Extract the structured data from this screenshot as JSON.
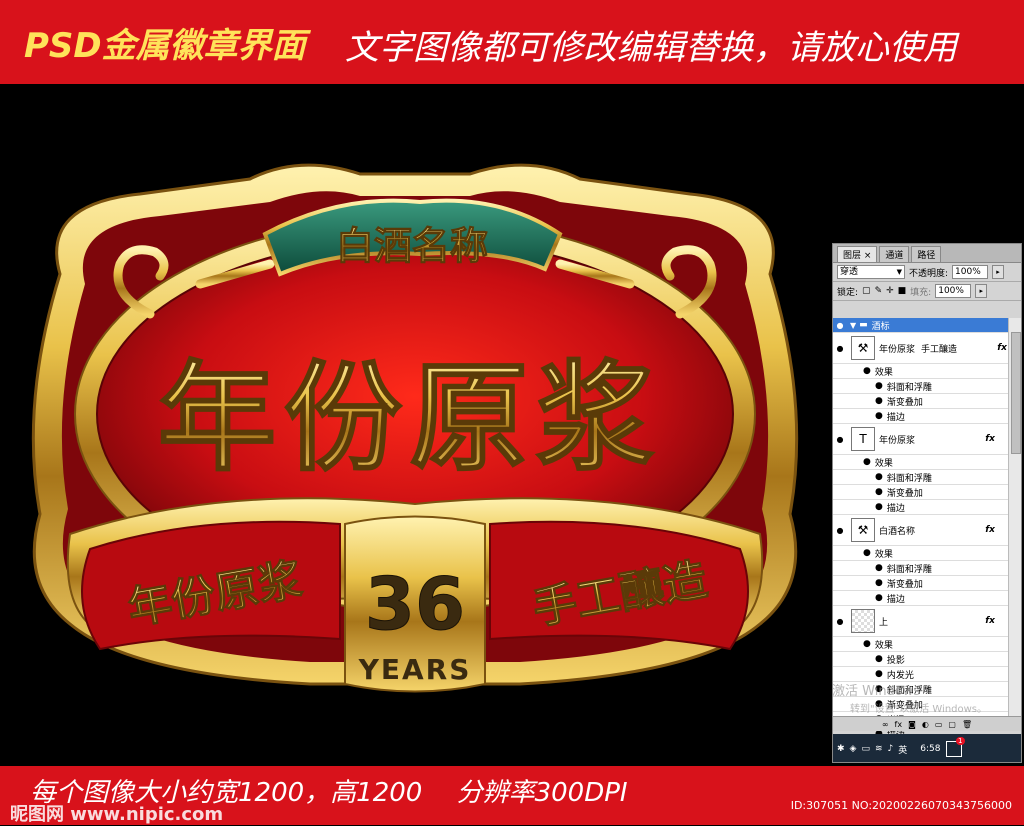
{
  "header": {
    "title": "PSD金属徽章界面",
    "subtitle": "文字图像都可修改编辑替换，请放心使用"
  },
  "footer": {
    "info": "每个图像大小约宽1200，高1200　 分辨率300DPI",
    "watermark": "昵图网 www.nipic.com",
    "id": "ID:307051 NO:20200226070343756000"
  },
  "badge": {
    "ribbon_text": "白酒名称",
    "main_text": "年份原浆",
    "left_label": "年份原浆",
    "right_label": "手工釀造",
    "number": "36",
    "years": "YEARS"
  },
  "colors": {
    "red": "#d8121b",
    "gold": "#e9c24a",
    "green": "#1e6b56",
    "yellow": "#ffe35a"
  },
  "ps_panel": {
    "tabs": [
      "图层 ×",
      "通道",
      "路径"
    ],
    "blend_mode": "穿透",
    "opacity_label": "不透明度:",
    "opacity_value": "100%",
    "lock_label": "锁定:",
    "fill_label": "填充:",
    "fill_value": "100%",
    "group_name": "酒标",
    "layer1_name": "年份原浆",
    "layer1_extra": "手工釀造",
    "layer2_name": "年份原浆",
    "layer3_name": "白酒名称",
    "layer4_name": "上",
    "fx": "fx",
    "effects_label": "效果",
    "effects_a": [
      "斜面和浮雕",
      "渐变叠加",
      "描边"
    ],
    "effects_b": [
      "斜面和浮雕",
      "渐变叠加",
      "描边"
    ],
    "effects_c": [
      "斜面和浮雕",
      "渐变叠加",
      "描边"
    ],
    "effects_d": [
      "投影",
      "内发光",
      "斜面和浮雕",
      "渐变叠加",
      "光泽",
      "描边"
    ],
    "activate_text": "激活 Windows",
    "activate_sub": "转到\"设置\"以激活 Windows。",
    "clock": "6:58",
    "notification_count": "1"
  }
}
